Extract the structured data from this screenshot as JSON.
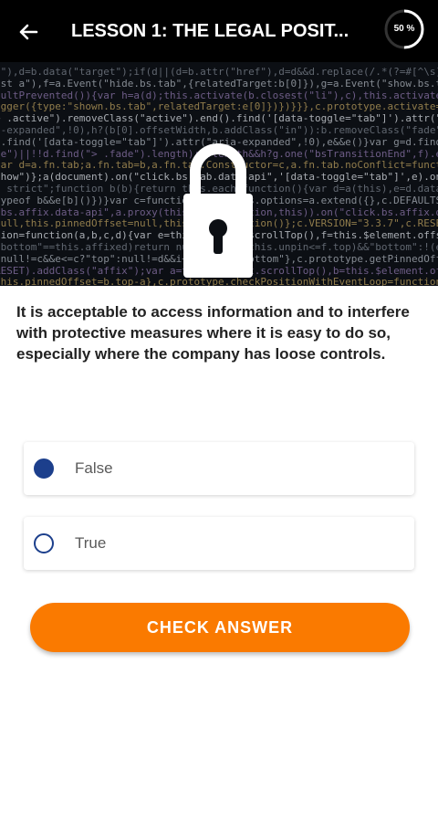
{
  "header": {
    "title": "LESSON 1: THE LEGAL POSIT...",
    "back_icon": "arrow-left-icon",
    "progress_label": "50 %",
    "progress_value": 0.5
  },
  "hero": {
    "lock_icon": "padlock-icon",
    "code_lines": [
      "n\"),d=b.data(\"target\");if(d||(d=b.attr(\"href\"),d=d&&d.replace(/.*(?=#[^\\s]*$)/,\"\")),",
      "ast a\"),f=a.Event(\"hide.bs.tab\",{relatedTarget:b[0]}),g=a.Event(\"show.bs.tab\",{relatedTarget:e[0]",
      "aultPrevented()){var h=a(d);this.activate(b.closest(\"li\"),c),this.activate(h,h.parent(),function",
      "igger({type:\"shown.bs.tab\",relatedTarget:e[0]})})}}},c.prototype.activate=function(b,d,e){func",
      " > .active\").removeClass(\"active\").end().find('[data-toggle=\"tab\"]').attr(\"aria-expanded\",!1),",
      "a-expanded\",!0),h?(b[0].offsetWidth,b.addClass(\"in\")):b.removeClass(\"fade\"),b.parent(\".dropdo",
      ").find('[data-toggle=\"tab\"]').attr(\"aria-expanded\",!0),e&&e()}var g=d.find(\"> .active\"),h=e&&",
      "de\")||!!d.find(\"> .fade\").length);g.length&&h?g.one(\"bsTransitionEnd\",f).emulateTransitionEnd",
      "var d=a.fn.tab;a.fn.tab=b,a.fn.tab.Constructor=c,a.fn.tab.noConflict=function(){return a.fn.t",
      "show\")};a(document).on(\"click.bs.tab.data-api\",'[data-toggle=\"tab\"]',e).on(\"click.bs.tab.data",
      "e strict\";function b(b){return this.each(function(){var d=a(this),e=d.data(\"bs.affix\"),f=\"ob",
      "typeof b&&e[b]()})}var c=function(b,d){this.options=a.extend({},c.DEFAULTS,d),this.$target=a",
      ".bs.affix.data-api\",a.proxy(this.checkPosition,this)).on(\"click.bs.affix.data-api\",a.proxy(this.checkPositionW",
      "null,this.pinnedOffset=null,this.checkPosition()};c.VERSION=\"3.3.7\",c.RESET=\"affix affix-top",
      "tion=function(a,b,c,d){var e=this.$target.scrollTop(),f=this.$element.offset(),g=this.$targ",
      "\"bottom\"==this.affixed)return null!=c?!(e+this.unpin<=f.top)&&\"bottom\":!(e+g<=a-d)&&\"bot",
      ":null!=c&&e<=c?\"top\":null!=d&&i+j>=a-d&&\"bottom\"},c.prototype.getPinnedOffset=function(){",
      "RESET).addClass(\"affix\");var a=this.$target.scrollTop(),b=this.$element.offset();return",
      "this.pinnedOffset=b.top-a},c.prototype.checkPositionWithEventLoop=function(){setTimeout(a"
    ]
  },
  "question": {
    "text": "It is acceptable to access information and to interfere with protective measures where it is easy to do so, especially where the company has loose controls."
  },
  "options": [
    {
      "label": "False",
      "selected": true
    },
    {
      "label": "True",
      "selected": false
    }
  ],
  "check_button": {
    "label": "CHECK ANSWER"
  },
  "colors": {
    "header_bg": "#000000",
    "radio_blue": "#1c3f8c",
    "button_orange": "#fa7a00"
  }
}
